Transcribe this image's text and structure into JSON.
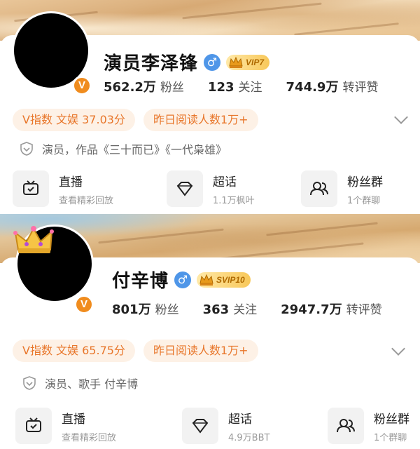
{
  "profiles": [
    {
      "name": "演员李泽锋",
      "gender_symbol": "♂",
      "verified_letter": "V",
      "vip_label": "VIP7",
      "stats": [
        {
          "value": "562.2万",
          "label": "粉丝"
        },
        {
          "value": "123",
          "label": "关注"
        },
        {
          "value": "744.9万",
          "label": "转评赞"
        }
      ],
      "pills": [
        "V指数 文娱 37.03分",
        "昨日阅读人数1万+"
      ],
      "description": "演员，作品《三十而已》《一代枭雄》",
      "tiles": [
        {
          "icon": "live-tv-icon",
          "title": "直播",
          "subtitle": "查看精彩回放"
        },
        {
          "icon": "diamond-icon",
          "title": "超话",
          "subtitle": "1.1万枫叶"
        },
        {
          "icon": "fan-group-icon",
          "title": "粉丝群",
          "subtitle": "1个群聊"
        }
      ]
    },
    {
      "name": "付辛博",
      "gender_symbol": "♂",
      "verified_letter": "V",
      "vip_label": "SVIP10",
      "stats": [
        {
          "value": "801万",
          "label": "粉丝"
        },
        {
          "value": "363",
          "label": "关注"
        },
        {
          "value": "2947.7万",
          "label": "转评赞"
        }
      ],
      "pills": [
        "V指数 文娱 65.75分",
        "昨日阅读人数1万+"
      ],
      "description": "演员、歌手 付辛博",
      "tiles": [
        {
          "icon": "live-tv-icon",
          "title": "直播",
          "subtitle": "查看精彩回放"
        },
        {
          "icon": "diamond-icon",
          "title": "超话",
          "subtitle": "4.9万BBT"
        },
        {
          "icon": "fan-group-icon",
          "title": "粉丝群",
          "subtitle": "1个群聊"
        }
      ]
    }
  ],
  "colors": {
    "accent_orange": "#e8762a",
    "pill_bg": "#fdf1e6",
    "gender_blue": "#4f96e8",
    "verified_orange": "#f08c1e",
    "vip_gold": "#f8c85a"
  }
}
